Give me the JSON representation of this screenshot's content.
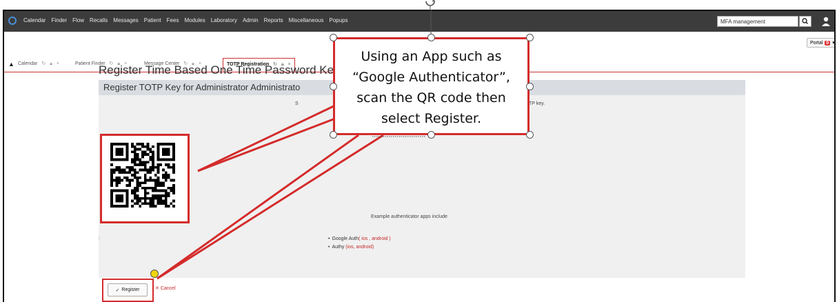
{
  "navbar": {
    "menu": [
      "Calendar",
      "Finder",
      "Flow",
      "Recalls",
      "Messages",
      "Patient",
      "Fees",
      "Modules",
      "Laboratory",
      "Admin",
      "Reports",
      "Miscellaneous",
      "Popups"
    ],
    "search_value": "MFA management",
    "portal_label": "Portal",
    "portal_badge": "0"
  },
  "tabs": [
    {
      "label": "Calendar",
      "active": false
    },
    {
      "label": "Patient Finder",
      "active": false
    },
    {
      "label": "Message Center",
      "active": false
    },
    {
      "label": "TOTP Registration",
      "active": true
    }
  ],
  "main": {
    "page_title": "Register Time Based One Time Password Ke",
    "panel_title": "Register TOTP Key for Administrator Administrato",
    "instruction_start": "S",
    "instruction_end": "TP key.",
    "example_heading": "Example authenticator apps include",
    "apps": [
      {
        "name": "Google Auth",
        "open": "( ",
        "link1": "ios",
        "sep": " , ",
        "link2": "android",
        "close": " )"
      },
      {
        "name": "Authy",
        "open": " (",
        "link1": "ios",
        "sep": ", ",
        "link2": "android",
        "close": ")"
      }
    ],
    "left_mark": ":",
    "register_label": "Register",
    "cancel_label": "Cancel"
  },
  "annotation": {
    "callout_lines": [
      "Using an App such as",
      "“Google Authenticator”,",
      "scan the QR code then",
      "select Register."
    ],
    "highlight_color": "#d42b2b"
  },
  "icons": {
    "search": "search-icon",
    "user": "user-icon",
    "tab_collapse": "caret-up-icon",
    "tab_refresh": "refresh-icon",
    "tab_lock": "lock-icon",
    "tab_close": "close-icon",
    "check": "check-icon",
    "cancel": "x-icon",
    "rotate": "rotate-handle-icon"
  }
}
